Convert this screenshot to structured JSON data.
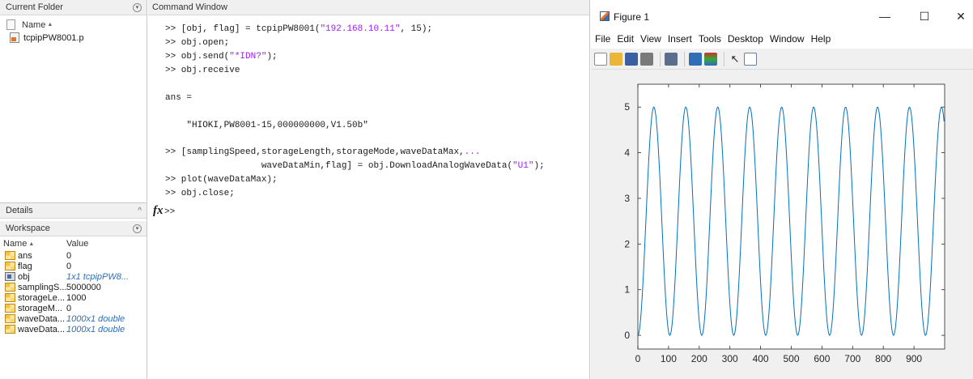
{
  "current_folder": {
    "title": "Current Folder",
    "name_header": "Name",
    "sort_glyph": "▲",
    "files": [
      {
        "name": "tcpipPW8001.p",
        "icon": "p-file-icon"
      }
    ]
  },
  "details": {
    "title": "Details",
    "toggle": "^"
  },
  "workspace": {
    "title": "Workspace",
    "name_header": "Name",
    "sort_glyph": "▲",
    "value_header": "Value",
    "vars": [
      {
        "name": "ans",
        "value": "0",
        "type": "numeric",
        "icon": "matrix-icon"
      },
      {
        "name": "flag",
        "value": "0",
        "type": "numeric",
        "icon": "matrix-icon"
      },
      {
        "name": "obj",
        "value": "1x1 tcpipPW8...",
        "type": "object",
        "icon": "object-icon"
      },
      {
        "name": "samplingS...",
        "value": "5000000",
        "type": "numeric",
        "icon": "matrix-icon"
      },
      {
        "name": "storageLe...",
        "value": "1000",
        "type": "numeric",
        "icon": "matrix-icon"
      },
      {
        "name": "storageM...",
        "value": "0",
        "type": "numeric",
        "icon": "matrix-icon"
      },
      {
        "name": "waveData...",
        "value": "1000x1 double",
        "type": "array",
        "icon": "matrix-icon"
      },
      {
        "name": "waveData...",
        "value": "1000x1 double",
        "type": "array",
        "icon": "matrix-icon"
      }
    ]
  },
  "command_window": {
    "title": "Command Window",
    "lines": [
      {
        "parts": [
          {
            "t": ">> [obj, flag] = tcpipPW8001("
          },
          {
            "t": "\"192.168.10.11\"",
            "s": true
          },
          {
            "t": ", 15);"
          }
        ]
      },
      {
        "parts": [
          {
            "t": ">> obj.open;"
          }
        ]
      },
      {
        "parts": [
          {
            "t": ">> obj.send("
          },
          {
            "t": "\"*IDN?\"",
            "s": true
          },
          {
            "t": ");"
          }
        ]
      },
      {
        "parts": [
          {
            "t": ">> obj.receive"
          }
        ]
      },
      {
        "parts": [
          {
            "t": "ans ="
          }
        ]
      },
      {
        "parts": [
          {
            "t": "    \"HIOKI,PW8001-15,000000000,V1.50b\""
          }
        ]
      },
      {
        "parts": [
          {
            "t": ">> [samplingSpeed,storageLength,storageMode,waveDataMax,"
          },
          {
            "t": "...",
            "s": true
          }
        ]
      },
      {
        "parts": [
          {
            "t": "                  waveDataMin,flag] = obj.DownloadAnalogWaveData("
          },
          {
            "t": "\"U1\"",
            "s": true
          },
          {
            "t": ");"
          }
        ]
      },
      {
        "parts": [
          {
            "t": ">> plot(waveDataMax);"
          }
        ]
      },
      {
        "parts": [
          {
            "t": ">> obj.close;"
          }
        ]
      }
    ],
    "fx_symbol": "fx",
    "prompt": ">>"
  },
  "figure": {
    "title": "Figure 1",
    "controls": {
      "minimize": "—",
      "maximize": "☐",
      "close": "✕"
    },
    "menus": [
      "File",
      "Edit",
      "View",
      "Insert",
      "Tools",
      "Desktop",
      "Window",
      "Help"
    ],
    "toolbar_icons": [
      "new-figure-icon",
      "open-file-icon",
      "save-icon",
      "print-icon",
      "print-preview-icon",
      "link-plot-icon",
      "insert-colorbar-icon",
      "insert-legend-icon",
      "edit-plot-icon",
      "property-inspector-icon"
    ]
  },
  "chart_data": {
    "type": "line",
    "title": "",
    "xlabel": "",
    "ylabel": "",
    "xlim": [
      0,
      1000
    ],
    "ylim": [
      -0.3,
      5.5
    ],
    "xticks": [
      0,
      100,
      200,
      300,
      400,
      500,
      600,
      700,
      800,
      900
    ],
    "yticks": [
      0,
      1,
      2,
      3,
      4,
      5
    ],
    "grid": false,
    "series": [
      {
        "color": "#0072bd",
        "waveform": "sinusoid",
        "min": 0,
        "max": 5,
        "cycles": 9.6,
        "n_points": 1000,
        "start_value": 0
      }
    ]
  }
}
